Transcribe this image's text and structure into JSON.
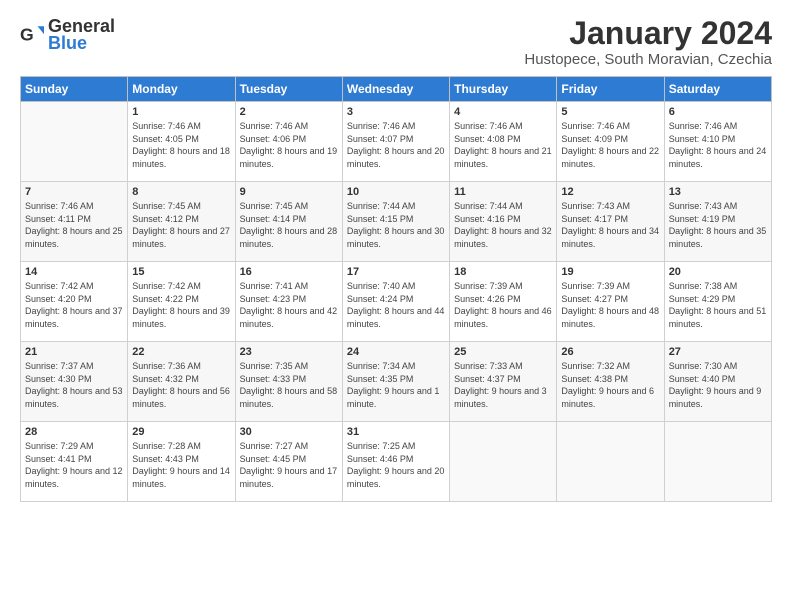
{
  "logo": {
    "text_general": "General",
    "text_blue": "Blue"
  },
  "title": "January 2024",
  "subtitle": "Hustopece, South Moravian, Czechia",
  "calendar": {
    "headers": [
      "Sunday",
      "Monday",
      "Tuesday",
      "Wednesday",
      "Thursday",
      "Friday",
      "Saturday"
    ],
    "weeks": [
      [
        {
          "day": "",
          "sunrise": "",
          "sunset": "",
          "daylight": ""
        },
        {
          "day": "1",
          "sunrise": "Sunrise: 7:46 AM",
          "sunset": "Sunset: 4:05 PM",
          "daylight": "Daylight: 8 hours and 18 minutes."
        },
        {
          "day": "2",
          "sunrise": "Sunrise: 7:46 AM",
          "sunset": "Sunset: 4:06 PM",
          "daylight": "Daylight: 8 hours and 19 minutes."
        },
        {
          "day": "3",
          "sunrise": "Sunrise: 7:46 AM",
          "sunset": "Sunset: 4:07 PM",
          "daylight": "Daylight: 8 hours and 20 minutes."
        },
        {
          "day": "4",
          "sunrise": "Sunrise: 7:46 AM",
          "sunset": "Sunset: 4:08 PM",
          "daylight": "Daylight: 8 hours and 21 minutes."
        },
        {
          "day": "5",
          "sunrise": "Sunrise: 7:46 AM",
          "sunset": "Sunset: 4:09 PM",
          "daylight": "Daylight: 8 hours and 22 minutes."
        },
        {
          "day": "6",
          "sunrise": "Sunrise: 7:46 AM",
          "sunset": "Sunset: 4:10 PM",
          "daylight": "Daylight: 8 hours and 24 minutes."
        }
      ],
      [
        {
          "day": "7",
          "sunrise": "Sunrise: 7:46 AM",
          "sunset": "Sunset: 4:11 PM",
          "daylight": "Daylight: 8 hours and 25 minutes."
        },
        {
          "day": "8",
          "sunrise": "Sunrise: 7:45 AM",
          "sunset": "Sunset: 4:12 PM",
          "daylight": "Daylight: 8 hours and 27 minutes."
        },
        {
          "day": "9",
          "sunrise": "Sunrise: 7:45 AM",
          "sunset": "Sunset: 4:14 PM",
          "daylight": "Daylight: 8 hours and 28 minutes."
        },
        {
          "day": "10",
          "sunrise": "Sunrise: 7:44 AM",
          "sunset": "Sunset: 4:15 PM",
          "daylight": "Daylight: 8 hours and 30 minutes."
        },
        {
          "day": "11",
          "sunrise": "Sunrise: 7:44 AM",
          "sunset": "Sunset: 4:16 PM",
          "daylight": "Daylight: 8 hours and 32 minutes."
        },
        {
          "day": "12",
          "sunrise": "Sunrise: 7:43 AM",
          "sunset": "Sunset: 4:17 PM",
          "daylight": "Daylight: 8 hours and 34 minutes."
        },
        {
          "day": "13",
          "sunrise": "Sunrise: 7:43 AM",
          "sunset": "Sunset: 4:19 PM",
          "daylight": "Daylight: 8 hours and 35 minutes."
        }
      ],
      [
        {
          "day": "14",
          "sunrise": "Sunrise: 7:42 AM",
          "sunset": "Sunset: 4:20 PM",
          "daylight": "Daylight: 8 hours and 37 minutes."
        },
        {
          "day": "15",
          "sunrise": "Sunrise: 7:42 AM",
          "sunset": "Sunset: 4:22 PM",
          "daylight": "Daylight: 8 hours and 39 minutes."
        },
        {
          "day": "16",
          "sunrise": "Sunrise: 7:41 AM",
          "sunset": "Sunset: 4:23 PM",
          "daylight": "Daylight: 8 hours and 42 minutes."
        },
        {
          "day": "17",
          "sunrise": "Sunrise: 7:40 AM",
          "sunset": "Sunset: 4:24 PM",
          "daylight": "Daylight: 8 hours and 44 minutes."
        },
        {
          "day": "18",
          "sunrise": "Sunrise: 7:39 AM",
          "sunset": "Sunset: 4:26 PM",
          "daylight": "Daylight: 8 hours and 46 minutes."
        },
        {
          "day": "19",
          "sunrise": "Sunrise: 7:39 AM",
          "sunset": "Sunset: 4:27 PM",
          "daylight": "Daylight: 8 hours and 48 minutes."
        },
        {
          "day": "20",
          "sunrise": "Sunrise: 7:38 AM",
          "sunset": "Sunset: 4:29 PM",
          "daylight": "Daylight: 8 hours and 51 minutes."
        }
      ],
      [
        {
          "day": "21",
          "sunrise": "Sunrise: 7:37 AM",
          "sunset": "Sunset: 4:30 PM",
          "daylight": "Daylight: 8 hours and 53 minutes."
        },
        {
          "day": "22",
          "sunrise": "Sunrise: 7:36 AM",
          "sunset": "Sunset: 4:32 PM",
          "daylight": "Daylight: 8 hours and 56 minutes."
        },
        {
          "day": "23",
          "sunrise": "Sunrise: 7:35 AM",
          "sunset": "Sunset: 4:33 PM",
          "daylight": "Daylight: 8 hours and 58 minutes."
        },
        {
          "day": "24",
          "sunrise": "Sunrise: 7:34 AM",
          "sunset": "Sunset: 4:35 PM",
          "daylight": "Daylight: 9 hours and 1 minute."
        },
        {
          "day": "25",
          "sunrise": "Sunrise: 7:33 AM",
          "sunset": "Sunset: 4:37 PM",
          "daylight": "Daylight: 9 hours and 3 minutes."
        },
        {
          "day": "26",
          "sunrise": "Sunrise: 7:32 AM",
          "sunset": "Sunset: 4:38 PM",
          "daylight": "Daylight: 9 hours and 6 minutes."
        },
        {
          "day": "27",
          "sunrise": "Sunrise: 7:30 AM",
          "sunset": "Sunset: 4:40 PM",
          "daylight": "Daylight: 9 hours and 9 minutes."
        }
      ],
      [
        {
          "day": "28",
          "sunrise": "Sunrise: 7:29 AM",
          "sunset": "Sunset: 4:41 PM",
          "daylight": "Daylight: 9 hours and 12 minutes."
        },
        {
          "day": "29",
          "sunrise": "Sunrise: 7:28 AM",
          "sunset": "Sunset: 4:43 PM",
          "daylight": "Daylight: 9 hours and 14 minutes."
        },
        {
          "day": "30",
          "sunrise": "Sunrise: 7:27 AM",
          "sunset": "Sunset: 4:45 PM",
          "daylight": "Daylight: 9 hours and 17 minutes."
        },
        {
          "day": "31",
          "sunrise": "Sunrise: 7:25 AM",
          "sunset": "Sunset: 4:46 PM",
          "daylight": "Daylight: 9 hours and 20 minutes."
        },
        {
          "day": "",
          "sunrise": "",
          "sunset": "",
          "daylight": ""
        },
        {
          "day": "",
          "sunrise": "",
          "sunset": "",
          "daylight": ""
        },
        {
          "day": "",
          "sunrise": "",
          "sunset": "",
          "daylight": ""
        }
      ]
    ]
  }
}
